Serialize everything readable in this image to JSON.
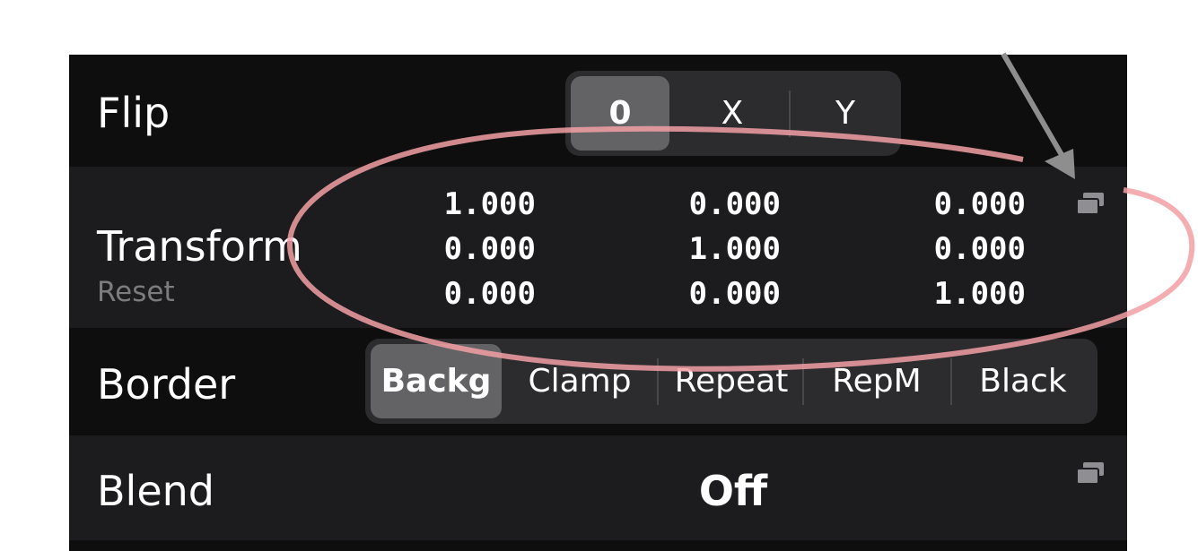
{
  "flip": {
    "label": "Flip",
    "options": [
      "0",
      "X",
      "Y"
    ],
    "selected": "0"
  },
  "transform": {
    "label": "Transform",
    "reset_label": "Reset",
    "matrix": [
      [
        "1.000",
        "0.000",
        "0.000"
      ],
      [
        "0.000",
        "1.000",
        "0.000"
      ],
      [
        "0.000",
        "0.000",
        "1.000"
      ]
    ],
    "copy_icon": "copy-icon"
  },
  "border": {
    "label": "Border",
    "options": [
      "Backg",
      "Clamp",
      "Repeat",
      "RepM",
      "Black"
    ],
    "selected": "Backg"
  },
  "blend": {
    "label": "Blend",
    "value": "Off",
    "copy_icon": "copy-icon"
  },
  "annotation": {
    "ellipse_color": "#f2a0a4",
    "arrow_color": "#8e8e8e"
  },
  "colors": {
    "panel_bg": "#0e0e0e",
    "row_alt_bg": "#1c1c1e",
    "segment_bg": "#2c2c2e",
    "segment_selected": "#636366",
    "text": "#ffffff",
    "secondary_text": "#7c7c80"
  }
}
